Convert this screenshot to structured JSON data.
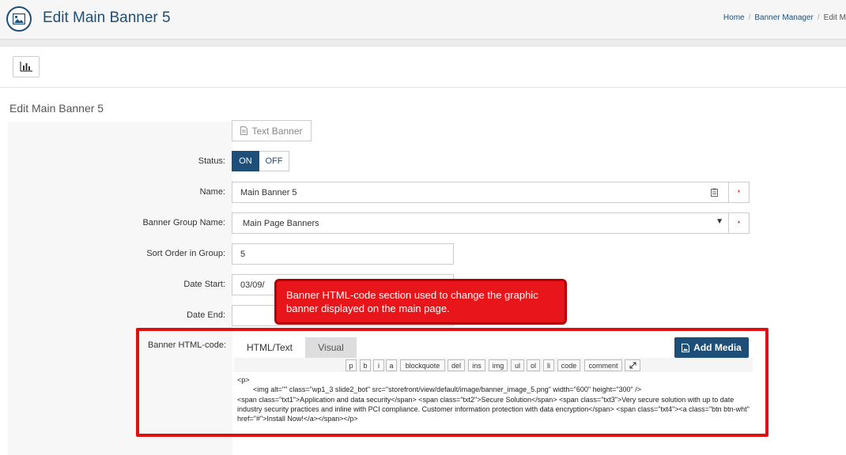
{
  "header": {
    "title": "Edit Main Banner 5",
    "breadcrumb": [
      "Home",
      "Banner Manager",
      "Edit M"
    ]
  },
  "section_title": "Edit Main Banner 5",
  "text_banner_label": "Text Banner",
  "form": {
    "status_label": "Status:",
    "status_on": "ON",
    "status_off": "OFF",
    "name_label": "Name:",
    "name_value": "Main Banner 5",
    "group_label": "Banner Group Name:",
    "group_value": "Main Page Banners",
    "sort_label": "Sort Order in Group:",
    "sort_value": "5",
    "date_start_label": "Date Start:",
    "date_start_value": "03/09/",
    "date_end_label": "Date End:",
    "date_end_value": "",
    "required_mark": "*",
    "html_label": "Banner HTML-code:"
  },
  "callout_text": "Banner HTML-code section used to change the graphic banner displayed on the main page.",
  "editor": {
    "tab_html": "HTML/Text",
    "tab_visual": "Visual",
    "add_media": "Add Media",
    "quicktags": [
      "p",
      "b",
      "i",
      "a",
      "blockquote",
      "del",
      "ins",
      "img",
      "ul",
      "ol",
      "li",
      "code",
      "comment"
    ],
    "content": "<p>\n        <img alt=\"\" class=\"wp1_3 slide2_bot\" src=\"storefront/view/default/image/banner_image_5.png\" width=\"600\" height=\"300\" />\n<span class=\"txt1\">Application and data security</span> <span class=\"txt2\">Secure Solution</span> <span class=\"txt3\">Very secure solution with up to date industry security practices and inline with PCI compliance. Customer information protection with data encryption</span> <span class=\"txt4\"><a class=\"btn btn-wht\" href=\"#\">Install Now!</a></span></p>"
  },
  "colors": {
    "primary": "#1d4f78",
    "callout_bg": "#e8151b",
    "highlight_border": "#e01010"
  }
}
